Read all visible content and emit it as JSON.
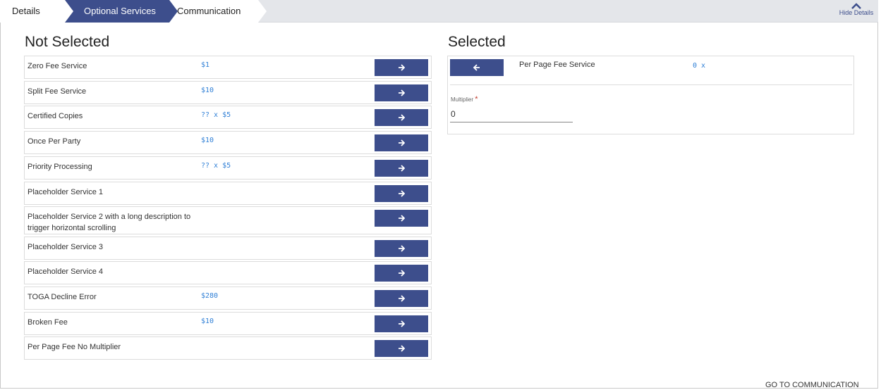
{
  "tabs": {
    "details": "Details",
    "optional": "Optional Services",
    "communication": "Communication"
  },
  "hide_details": "Hide Details",
  "not_selected": {
    "title": "Not Selected",
    "items": [
      {
        "name": "Zero Fee Service",
        "fee": "$1"
      },
      {
        "name": "Split Fee Service",
        "fee": "$10"
      },
      {
        "name": "Certified Copies",
        "fee": "?? x $5"
      },
      {
        "name": "Once Per Party",
        "fee": "$10"
      },
      {
        "name": "Priority Processing",
        "fee": "?? x $5"
      },
      {
        "name": "Placeholder Service 1",
        "fee": ""
      },
      {
        "name": "Placeholder Service 2 with a long description to trigger horizontal scrolling",
        "fee": ""
      },
      {
        "name": "Placeholder Service 3",
        "fee": ""
      },
      {
        "name": "Placeholder Service 4",
        "fee": ""
      },
      {
        "name": "TOGA Decline Error",
        "fee": "$280"
      },
      {
        "name": "Broken Fee",
        "fee": "$10"
      },
      {
        "name": "Per Page Fee No Multiplier",
        "fee": ""
      }
    ]
  },
  "selected": {
    "title": "Selected",
    "item": {
      "name": "Per Page Fee Service",
      "fee": "0 x"
    },
    "multiplier_label": "Multiplier",
    "multiplier_required": "*",
    "multiplier_value": "0"
  },
  "footer": {
    "go_communication": "GO TO COMMUNICATION"
  },
  "colors": {
    "accent": "#3d4e8c",
    "fee": "#2f7fd6",
    "required": "#c0392b"
  }
}
